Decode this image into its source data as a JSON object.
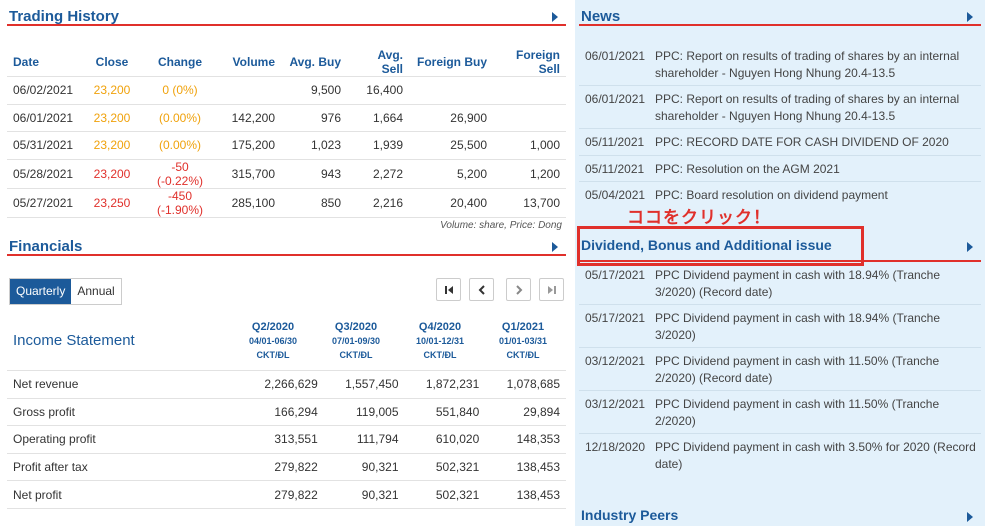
{
  "trading": {
    "title": "Trading History",
    "headers": [
      "Date",
      "Close",
      "Change",
      "Volume",
      "Avg. Buy",
      "Avg. Sell",
      "Foreign Buy",
      "Foreign Sell"
    ],
    "rows": [
      {
        "date": "06/02/2021",
        "close": "23,200",
        "change": "0 (0%)",
        "volume": "",
        "avg_buy": "9,500",
        "avg_sell": "16,400",
        "foreign_buy": "",
        "foreign_sell": "",
        "tone": "orange"
      },
      {
        "date": "06/01/2021",
        "close": "23,200",
        "change": "(0.00%)",
        "volume": "142,200",
        "avg_buy": "976",
        "avg_sell": "1,664",
        "foreign_buy": "26,900",
        "foreign_sell": "",
        "tone": "orange"
      },
      {
        "date": "05/31/2021",
        "close": "23,200",
        "change": "(0.00%)",
        "volume": "175,200",
        "avg_buy": "1,023",
        "avg_sell": "1,939",
        "foreign_buy": "25,500",
        "foreign_sell": "1,000",
        "tone": "orange"
      },
      {
        "date": "05/28/2021",
        "close": "23,200",
        "change": "-50 (-0.22%)",
        "volume": "315,700",
        "avg_buy": "943",
        "avg_sell": "2,272",
        "foreign_buy": "5,200",
        "foreign_sell": "1,200",
        "tone": "red"
      },
      {
        "date": "05/27/2021",
        "close": "23,250",
        "change": "-450 (-1.90%)",
        "volume": "285,100",
        "avg_buy": "850",
        "avg_sell": "2,216",
        "foreign_buy": "20,400",
        "foreign_sell": "13,700",
        "tone": "red"
      }
    ],
    "note": "Volume: share, Price: Dong"
  },
  "financials": {
    "title": "Financials",
    "tab_quarterly": "Quarterly",
    "tab_annual": "Annual",
    "statement_title": "Income Statement",
    "quarters": [
      {
        "q": "Q2/2020",
        "range": "04/01-06/30",
        "unit": "CKT/ĐL"
      },
      {
        "q": "Q3/2020",
        "range": "07/01-09/30",
        "unit": "CKT/ĐL"
      },
      {
        "q": "Q4/2020",
        "range": "10/01-12/31",
        "unit": "CKT/ĐL"
      },
      {
        "q": "Q1/2021",
        "range": "01/01-03/31",
        "unit": "CKT/ĐL"
      }
    ],
    "rows": [
      {
        "label": "Net revenue",
        "v": [
          "2,266,629",
          "1,557,450",
          "1,872,231",
          "1,078,685"
        ]
      },
      {
        "label": "Gross profit",
        "v": [
          "166,294",
          "119,005",
          "551,840",
          "29,894"
        ]
      },
      {
        "label": "Operating profit",
        "v": [
          "313,551",
          "111,794",
          "610,020",
          "148,353"
        ]
      },
      {
        "label": "Profit after tax",
        "v": [
          "279,822",
          "90,321",
          "502,321",
          "138,453"
        ]
      },
      {
        "label": "Net profit",
        "v": [
          "279,822",
          "90,321",
          "502,321",
          "138,453"
        ]
      }
    ]
  },
  "news": {
    "title": "News",
    "items": [
      {
        "date": "06/01/2021",
        "text": "PPC: Report on results of trading of shares by an internal shareholder - Nguyen Hong Nhung 20.4-13.5"
      },
      {
        "date": "06/01/2021",
        "text": "PPC: Report on results of trading of shares by an internal shareholder - Nguyen Hong Nhung 20.4-13.5"
      },
      {
        "date": "05/11/2021",
        "text": "PPC: RECORD DATE FOR CASH DIVIDEND OF 2020"
      },
      {
        "date": "05/11/2021",
        "text": "PPC: Resolution on the AGM 2021"
      },
      {
        "date": "05/04/2021",
        "text": "PPC: Board resolution on dividend payment"
      }
    ]
  },
  "callout": "ココをクリック！",
  "dividend": {
    "title": "Dividend, Bonus and Additional issue",
    "items": [
      {
        "date": "05/17/2021",
        "text": "PPC Dividend payment in cash with 18.94% (Tranche 3/2020) (Record date)"
      },
      {
        "date": "05/17/2021",
        "text": "PPC Dividend payment in cash with 18.94% (Tranche 3/2020)"
      },
      {
        "date": "03/12/2021",
        "text": "PPC Dividend payment in cash with 11.50% (Tranche 2/2020) (Record date)"
      },
      {
        "date": "03/12/2021",
        "text": "PPC Dividend payment in cash with 11.50% (Tranche 2/2020)"
      },
      {
        "date": "12/18/2020",
        "text": "PPC Dividend payment in cash with 3.50% for 2020 (Record date)"
      }
    ]
  },
  "peers": {
    "title": "Industry Peers"
  },
  "colors": {
    "accent": "#1c5a9a",
    "divider": "#e0302b",
    "up_flat": "#f0a20c",
    "down": "#e0302b",
    "panel": "#e3f1fb"
  },
  "icons": [
    "chevron-right-icon",
    "first-page-icon",
    "prev-page-icon",
    "next-page-icon",
    "last-page-icon"
  ]
}
